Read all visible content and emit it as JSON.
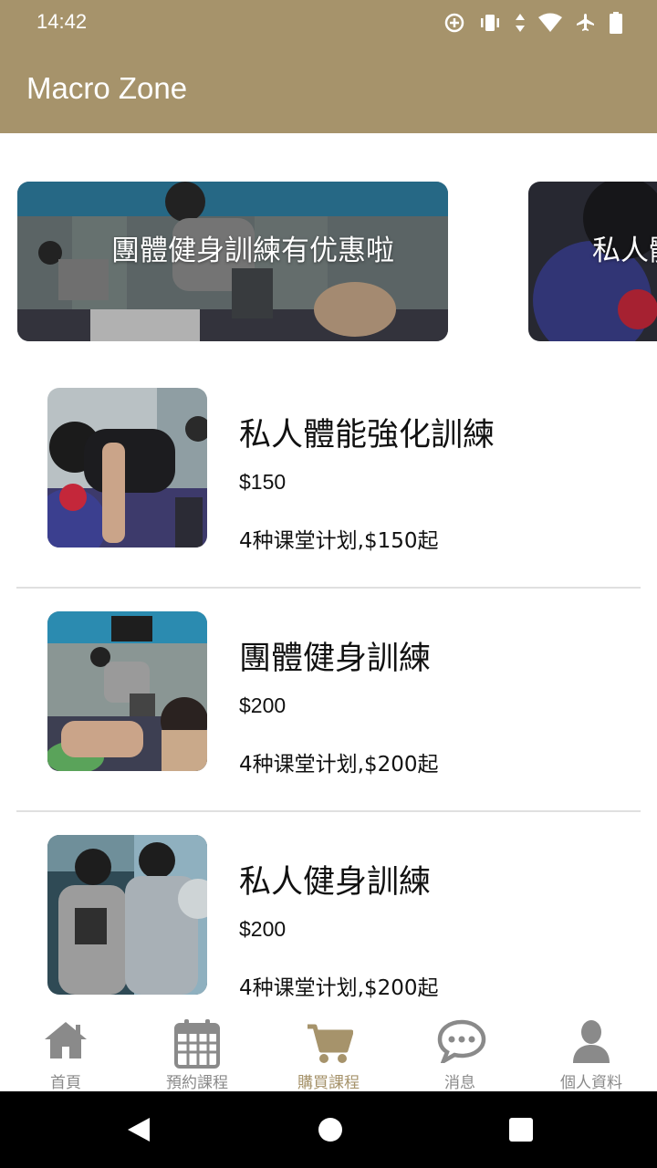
{
  "status_bar": {
    "time": "14:42"
  },
  "app_bar": {
    "title": "Macro Zone"
  },
  "banners": [
    {
      "text": "團體健身訓練有优惠啦"
    },
    {
      "text": "私人體"
    }
  ],
  "courses": [
    {
      "name": "私人體能強化訓練",
      "price": "$150",
      "plan": "4种课堂计划,$150起"
    },
    {
      "name": "團體健身訓練",
      "price": "$200",
      "plan": "4种课堂计划,$200起"
    },
    {
      "name": "私人健身訓練",
      "price": "$200",
      "plan": "4种课堂计划,$200起"
    }
  ],
  "bottom_nav": {
    "items": [
      {
        "label": "首頁",
        "icon": "home-icon"
      },
      {
        "label": "預約課程",
        "icon": "calendar-icon"
      },
      {
        "label": "購買課程",
        "icon": "cart-icon"
      },
      {
        "label": "消息",
        "icon": "chat-icon"
      },
      {
        "label": "個人資料",
        "icon": "user-icon"
      }
    ],
    "active_index": 2
  },
  "colors": {
    "brand": "#a6936b",
    "inactive": "#8a8a8a"
  }
}
